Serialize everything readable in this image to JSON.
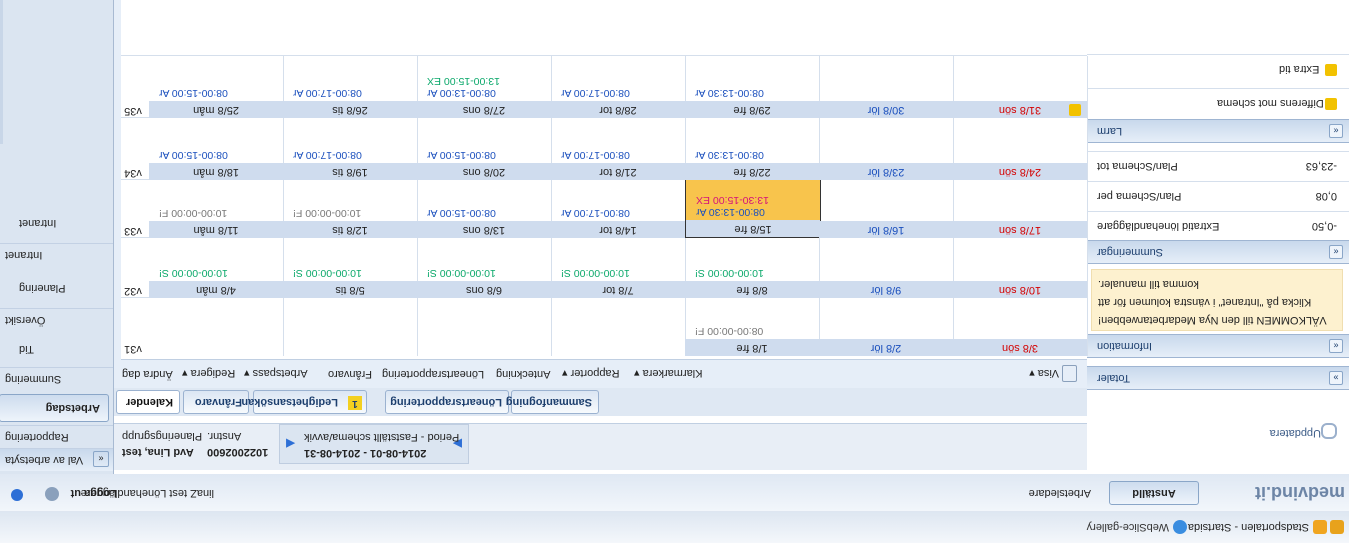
{
  "favorites": {
    "title1": "Stadsportalen - Startsida",
    "title2": "WebSlice-gallery"
  },
  "appbar": {
    "logo": "medvind.it",
    "tabs": [
      "Anställd",
      "Arbetsledare"
    ],
    "user_prefix": "linaZ test Lönehandläggare",
    "logout": "Logga ut"
  },
  "leftnav": {
    "title": "Val av arbetsyta",
    "items": [
      "Rapportering",
      "Arbetsdag",
      "Summering",
      "Tid",
      "Översikt",
      "Planering",
      "Intranet",
      "Intranet"
    ]
  },
  "context": {
    "employee_no": "1022002600",
    "employee_label": "Anstnr.",
    "planning_name": "Avd Lina, test",
    "planning_label": "Planeringsgrupp",
    "period": "2014-08-01 - 2014-08-31",
    "period_label": "Period - Fastställt schema/avvik"
  },
  "tabs": [
    "Kalender",
    "Frånvaro",
    "Ledighetsansökan",
    "Löneartsrapportering",
    "Sammanfogning"
  ],
  "tab_badge": "1",
  "toolbar": [
    "Ändra dag",
    "Redigera ▾",
    "Arbetspass ▾",
    "Frånvaro",
    "Löneartsrapportering",
    "Anteckning",
    "Rapporter ▾",
    "Klarmarkera ▾"
  ],
  "toolbar_right": "Visa ▾",
  "weeks": [
    {
      "num": "v31",
      "days": [
        {
          "d": "",
          "label": ""
        },
        {
          "d": "",
          "label": ""
        },
        {
          "d": "",
          "label": ""
        },
        {
          "d": "",
          "label": ""
        },
        {
          "d": "1/8 fre",
          "label": "08:00-00:00 F!"
        },
        {
          "d": "2/8 lör",
          "label": ""
        },
        {
          "d": "3/8 sön",
          "label": ""
        }
      ]
    },
    {
      "num": "v32",
      "days": [
        {
          "d": "4/8 mån",
          "label": "10:00-00:00 S!"
        },
        {
          "d": "5/8 tis",
          "label": "10:00-00:00 S!"
        },
        {
          "d": "6/8 ons",
          "label": "10:00-00:00 S!"
        },
        {
          "d": "7/8 tor",
          "label": "10:00-00:00 S!"
        },
        {
          "d": "8/8 fre",
          "label": "10:00-00:00 S!"
        },
        {
          "d": "9/8 lör",
          "label": ""
        },
        {
          "d": "10/8 sön",
          "label": ""
        }
      ]
    },
    {
      "num": "v33",
      "days": [
        {
          "d": "11/8 mån",
          "label": "10:00-00:00 F!"
        },
        {
          "d": "12/8 tis",
          "label": "10:00-00:00 F!"
        },
        {
          "d": "13/8 ons",
          "label": "08:00-15:00 Ar"
        },
        {
          "d": "14/8 tor",
          "label": "08:00-17:00 Ar"
        },
        {
          "d": "15/8 fre",
          "label": "08:00-13:30 Ar",
          "extra": "13:30-15:00 EX"
        },
        {
          "d": "16/8 lör",
          "label": ""
        },
        {
          "d": "17/8 sön",
          "label": ""
        }
      ]
    },
    {
      "num": "v34",
      "days": [
        {
          "d": "18/8 mån",
          "label": "08:00-15:00 Ar"
        },
        {
          "d": "19/8 tis",
          "label": "08:00-17:00 Ar"
        },
        {
          "d": "20/8 ons",
          "label": "08:00-15:00 Ar"
        },
        {
          "d": "21/8 tor",
          "label": "08:00-17:00 Ar"
        },
        {
          "d": "22/8 fre",
          "label": "08:00-13:30 Ar"
        },
        {
          "d": "23/8 lör",
          "label": ""
        },
        {
          "d": "24/8 sön",
          "label": ""
        }
      ]
    },
    {
      "num": "v35",
      "days": [
        {
          "d": "25/8 mån",
          "label": "08:00-15:00 Ar"
        },
        {
          "d": "26/8 tis",
          "label": "08:00-17:00 Ar"
        },
        {
          "d": "27/8 ons",
          "label": "08:00-13:00 Ar",
          "extra": "13:00-15:00 EX"
        },
        {
          "d": "28/8 tor",
          "label": "08:00-17:00 Ar"
        },
        {
          "d": "29/8 fre",
          "label": "08:00-13:30 Ar"
        },
        {
          "d": "30/8 lör",
          "label": ""
        },
        {
          "d": "31/8 sön",
          "label": ""
        }
      ]
    }
  ],
  "right": {
    "refresh": "Uppdatera",
    "totals": "Totaler",
    "information": "Information",
    "info_text1": "VÄLKOMMEN till den Nya Medarbetarwebben!",
    "info_text2": "Klicka på \"Intranet\" i vänstra kolumen för att",
    "info_text3": "komma till manualer.",
    "summeringar": "Summeringar",
    "sum_rows": [
      {
        "label": "Extratid lönehandläggare",
        "value": "-0,50"
      },
      {
        "label": "Plan/Schema per",
        "value": "0,08"
      },
      {
        "label": "Plan/Schema tot",
        "value": "-23,63"
      }
    ],
    "larm": "Larm",
    "larm_rows": [
      "Differens mot schema",
      "Extra tid"
    ]
  },
  "colors": {
    "weekend": "#d40000",
    "absence": "#0aa86a",
    "extra": "#d4127a",
    "work": "#1a4fbd",
    "highlight": "#f8c44c"
  }
}
